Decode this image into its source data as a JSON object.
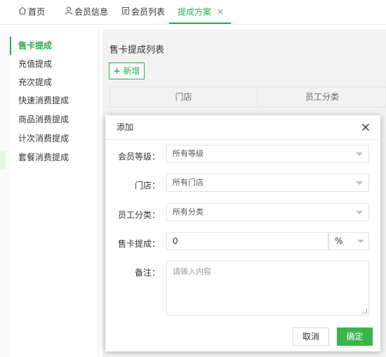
{
  "tabs": [
    {
      "label": "首页",
      "icon": "home-icon"
    },
    {
      "label": "会员信息",
      "icon": "user-icon"
    },
    {
      "label": "会员列表",
      "icon": "list-icon"
    },
    {
      "label": "提成方案",
      "icon": "",
      "active": true,
      "close": "✕"
    }
  ],
  "sidebar": {
    "items": [
      {
        "label": "售卡提成",
        "active": true
      },
      {
        "label": "充值提成"
      },
      {
        "label": "充次提成"
      },
      {
        "label": "快速消费提成"
      },
      {
        "label": "商品消费提成"
      },
      {
        "label": "计次消费提成"
      },
      {
        "label": "套餐消费提成"
      }
    ]
  },
  "main": {
    "title": "售卡提成列表",
    "add_button": "新增",
    "table_headers": [
      "门店",
      "员工分类"
    ]
  },
  "modal": {
    "title": "添加",
    "fields": {
      "member_level": {
        "label": "会员等级：",
        "value": "所有等级"
      },
      "store": {
        "label": "门店：",
        "value": "所有门店"
      },
      "staff_category": {
        "label": "员工分类：",
        "value": "所有分类"
      },
      "card_commission": {
        "label": "售卡提成：",
        "value": "0",
        "unit": "%"
      },
      "remark": {
        "label": "备注：",
        "placeholder": "请输入内容"
      }
    },
    "cancel_button": "取消",
    "ok_button": "确定"
  },
  "colors": {
    "accent": "#2aab4e",
    "ok_button": "#3ab54a"
  }
}
